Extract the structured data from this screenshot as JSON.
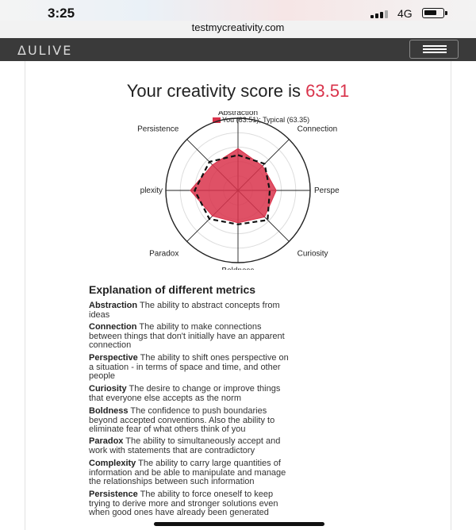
{
  "status": {
    "time": "3:25",
    "network": "4G"
  },
  "browser": {
    "url": "testmycreativity.com"
  },
  "nav": {
    "logo": "ΔULIVE"
  },
  "score": {
    "title": "Your creativity score is",
    "value": "63.51"
  },
  "legend": {
    "you": "You (63.51)",
    "typical": "Typical (63.35)"
  },
  "chart_data": {
    "type": "radar",
    "axes": [
      "Abstraction",
      "Connection",
      "Perspective",
      "Curiosity",
      "Boldness",
      "Paradox",
      "Complexity",
      "Persistence"
    ],
    "axis_labels_visible": [
      "Abstraction",
      "Connection",
      "Perspe",
      "Curiosity",
      "Boldness",
      "Paradox",
      "plexity",
      "Persistence"
    ],
    "range": [
      0,
      100
    ],
    "series": [
      {
        "name": "You (63.51)",
        "values": [
          58,
          48,
          53,
          52,
          45,
          50,
          66,
          50
        ],
        "color": "#d9334b",
        "style": "filled"
      },
      {
        "name": "Typical (63.35)",
        "values": [
          49,
          52,
          44,
          58,
          47,
          56,
          60,
          56
        ],
        "color": "#111111",
        "style": "dashed"
      }
    ],
    "grid": true,
    "legend_position": "top"
  },
  "explanation": {
    "title": "Explanation of different metrics",
    "items": [
      {
        "name": "Abstraction",
        "line1": " The ability to abstract concepts from",
        "line2": "ideas",
        "line3": ""
      },
      {
        "name": "Connection",
        "line1": " The ability to make connections",
        "line2": "between things that don't initially have an apparent",
        "line3": "connection"
      },
      {
        "name": "Perspective",
        "line1": " The ability to shift ones perspective on",
        "line2": "a situation - in terms of space and time, and other",
        "line3": "people"
      },
      {
        "name": "Curiosity",
        "line1": " The desire to change or improve things",
        "line2": "that everyone else accepts as the norm",
        "line3": ""
      },
      {
        "name": "Boldness",
        "line1": " The confidence to push boundaries",
        "line2": "beyond accepted conventions. Also the ability to",
        "line3": "eliminate fear of what others think of you"
      },
      {
        "name": "Paradox",
        "line1": " The ability to simultaneously accept and",
        "line2": "work with statements that are contradictory",
        "line3": ""
      },
      {
        "name": "Complexity",
        "line1": " The ability to carry large quantities of",
        "line2": "information and be able to manipulate and manage",
        "line3": "the relationships between such information"
      },
      {
        "name": "Persistence",
        "line1": " The ability to force oneself to keep",
        "line2": "trying to derive more and stronger solutions even",
        "line3": "when good ones have already been generated"
      }
    ]
  }
}
